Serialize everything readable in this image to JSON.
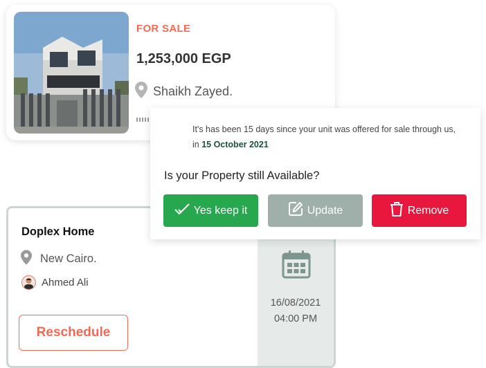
{
  "listing": {
    "status": "FOR SALE",
    "price": "1,253,000 EGP",
    "location": "Shaikh Zayed."
  },
  "popup": {
    "message_prefix": "It's has been 15 days since your unit was offered for sale through us, in ",
    "message_date": "15 October 2021",
    "question": "Is your Property still Available?",
    "buttons": {
      "keep": "Yes keep it",
      "update": "Update",
      "remove": "Remove"
    }
  },
  "appointment": {
    "title": "Doplex Home",
    "location": "New Cairo.",
    "agent": "Ahmed Ali",
    "reschedule_label": "Reschedule",
    "date": "16/08/2021",
    "time": "04:00 PM"
  },
  "colors": {
    "accent": "#f26a55",
    "keep": "#27a84f",
    "update": "#9fb0ab",
    "remove": "#e8173e",
    "date_highlight": "#1f4f3a"
  },
  "icons": [
    "location-pin-icon",
    "check-icon",
    "edit-icon",
    "trash-icon",
    "calendar-icon"
  ]
}
